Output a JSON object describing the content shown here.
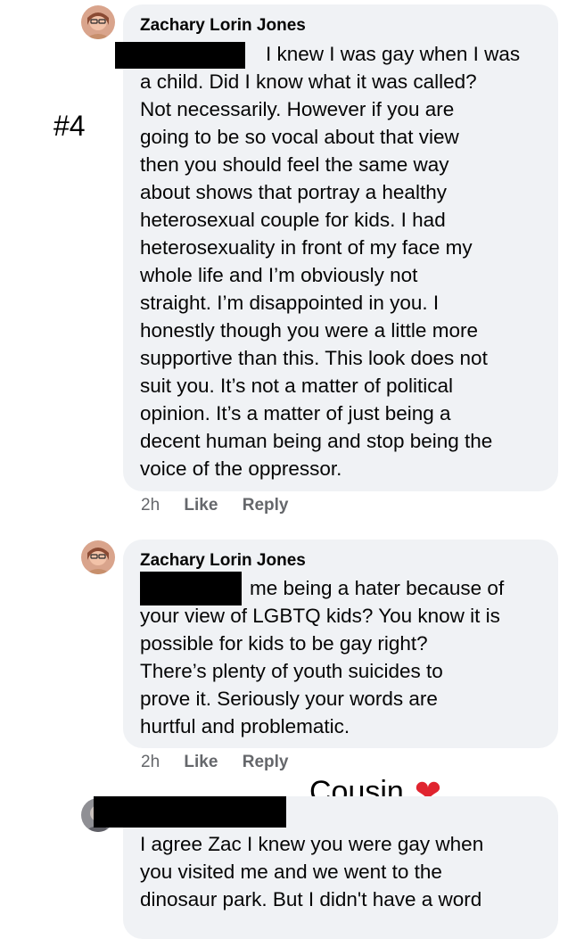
{
  "annotation": "#4",
  "comments": [
    {
      "author": "Zachary Lorin Jones",
      "text": "I knew I was gay when I was\na child. Did I know what it was called?\nNot necessarily. However if you are\ngoing to be so vocal about that view\nthen you should feel the same way\nabout shows that portray a healthy\nheterosexual couple for kids. I had\nheterosexuality in front of my face my\nwhole life and I’m obviously not\nstraight. I’m disappointed in you. I\nhonestly though you were a little more\nsupportive than this. This look does not\nsuit you. It’s not a matter of political\nopinion. It’s a matter of just being a\ndecent human being and stop being the\nvoice of the oppressor.",
      "time": "2h",
      "like": "Like",
      "reply": "Reply"
    },
    {
      "author": "Zachary Lorin Jones",
      "text": "me being a hater because of\nyour view of LGBTQ kids? You know it is\npossible for kids to be gay right?\nThere’s plenty of youth suicides to\nprove it. Seriously your words are\nhurtful and problematic.",
      "time": "2h",
      "like": "Like",
      "reply": "Reply"
    },
    {
      "text": "I agree Zac I knew you were gay when\nyou visited me and we went to the\ndinosaur park. But I didn't have a word"
    }
  ],
  "cousin_label": "Cousin",
  "heart": "❤"
}
